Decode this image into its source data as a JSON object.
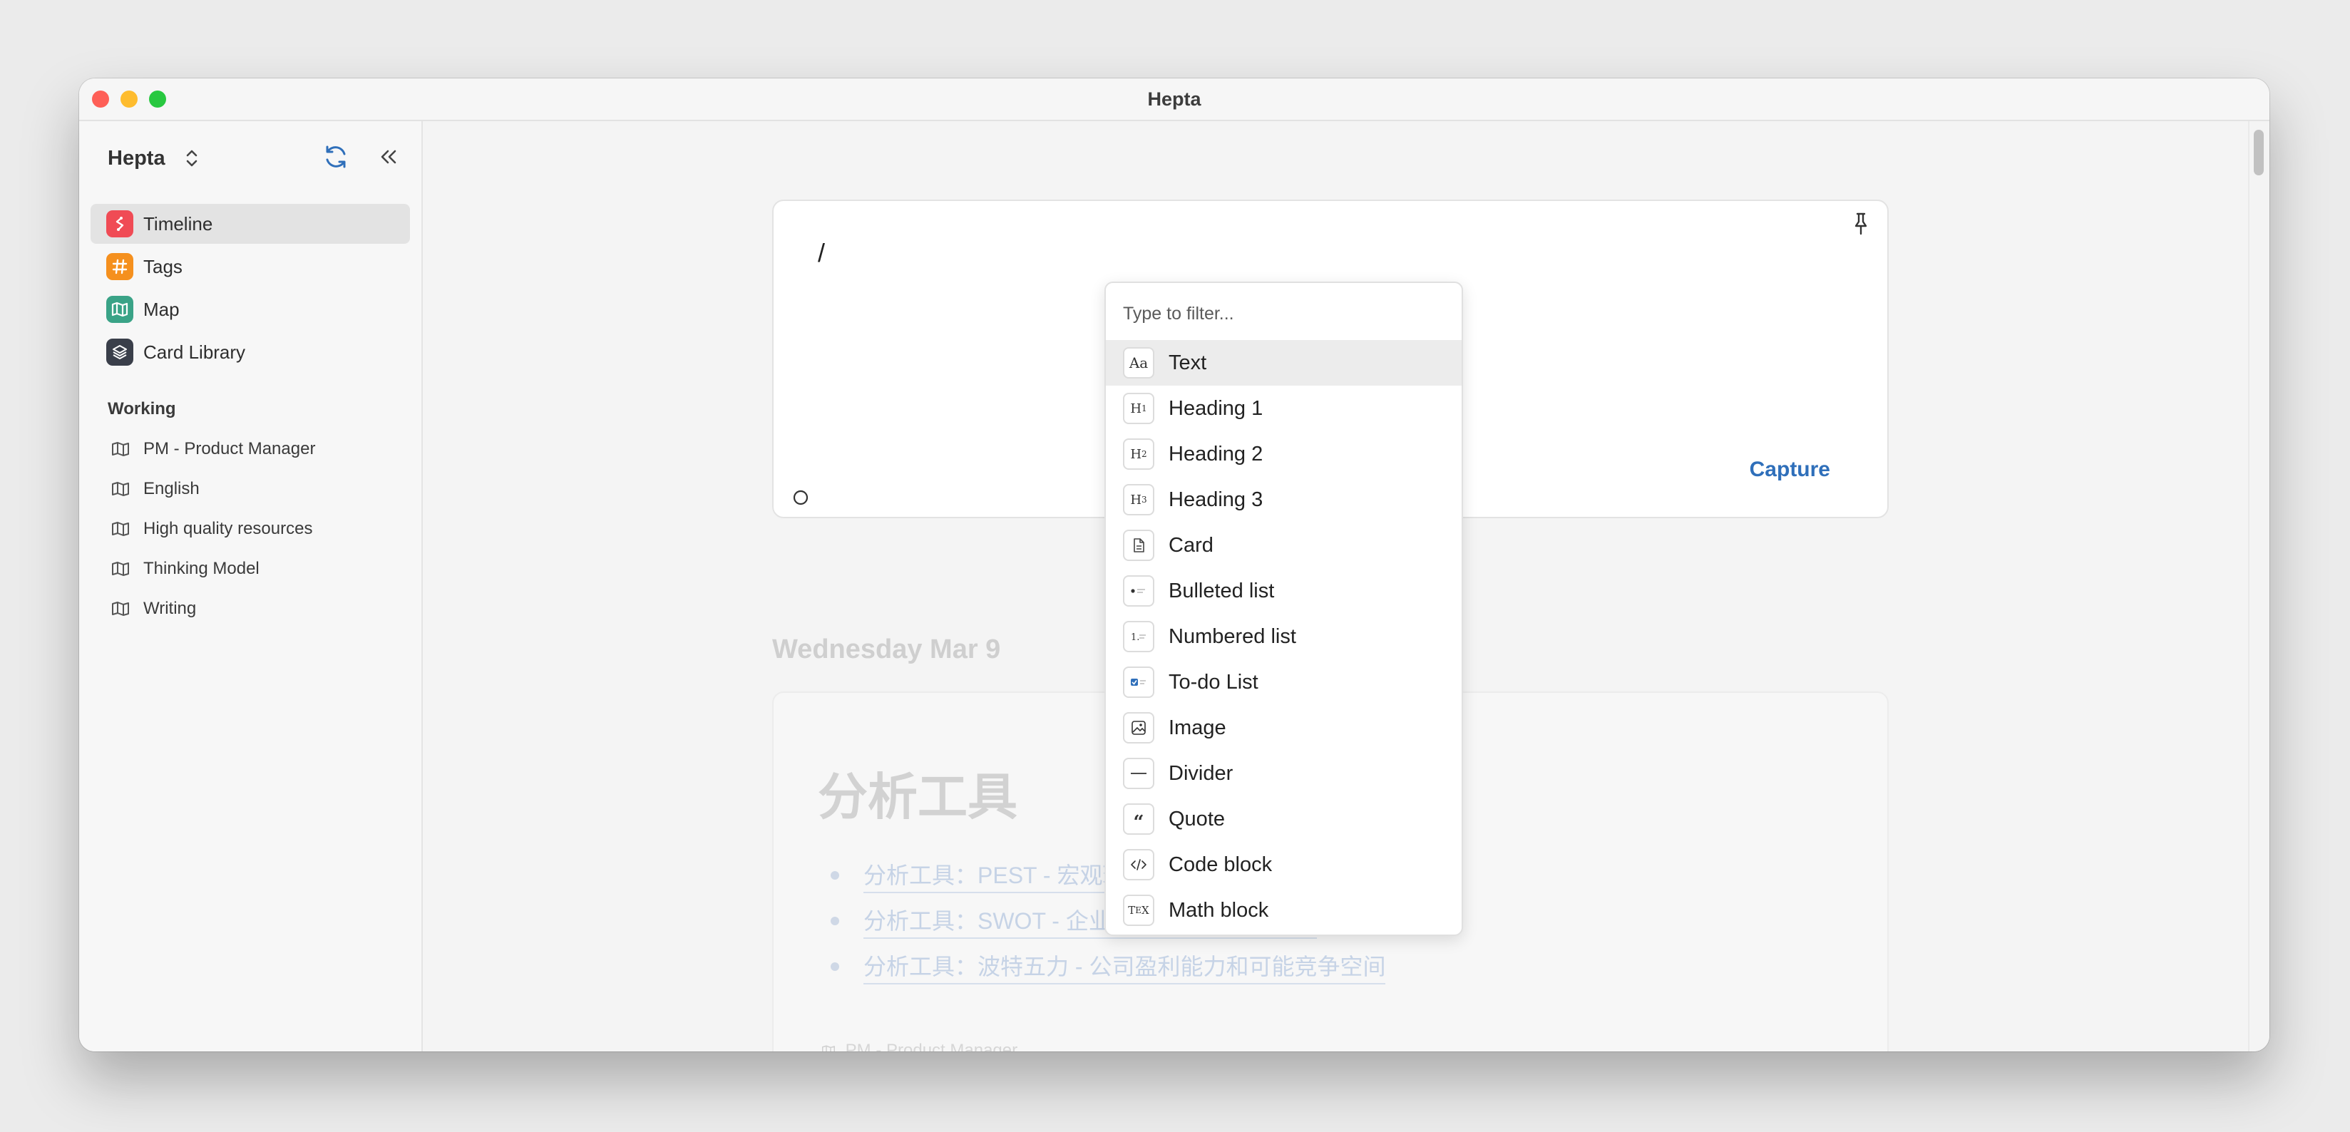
{
  "window": {
    "title": "Hepta"
  },
  "sidebar": {
    "workspace": "Hepta",
    "nav": [
      {
        "label": "Timeline",
        "icon": "timeline-icon",
        "color": "#f04b55",
        "active": true
      },
      {
        "label": "Tags",
        "icon": "hash-icon",
        "color": "#f5901e",
        "active": false
      },
      {
        "label": "Map",
        "icon": "map-icon",
        "color": "#3aa387",
        "active": false
      },
      {
        "label": "Card Library",
        "icon": "layers-icon",
        "color": "#3a3f4a",
        "active": false
      }
    ],
    "section_title": "Working",
    "working": [
      {
        "label": "PM - Product Manager"
      },
      {
        "label": "English"
      },
      {
        "label": "High quality resources"
      },
      {
        "label": "Thinking Model"
      },
      {
        "label": "Writing"
      }
    ]
  },
  "editor": {
    "content": "/",
    "capture_label": "Capture"
  },
  "timeline": {
    "date": "Wednesday Mar 9",
    "card_title": "分析工具",
    "links": [
      "分析工具：PEST - 宏观环境分析模型",
      "分析工具：SWOT - 企业内外部环境分析模型",
      "分析工具：波特五力 - 公司盈利能力和可能竞争空间"
    ],
    "footer_tag": "PM - Product Manager"
  },
  "slash_menu": {
    "filter_placeholder": "Type to filter...",
    "items": [
      {
        "label": "Text",
        "icon": "text-icon",
        "glyph": "Aa",
        "active": true
      },
      {
        "label": "Heading 1",
        "icon": "heading-1-icon",
        "glyph": "H1"
      },
      {
        "label": "Heading 2",
        "icon": "heading-2-icon",
        "glyph": "H2"
      },
      {
        "label": "Heading 3",
        "icon": "heading-3-icon",
        "glyph": "H3"
      },
      {
        "label": "Card",
        "icon": "card-icon",
        "glyph": ""
      },
      {
        "label": "Bulleted list",
        "icon": "bulleted-list-icon",
        "glyph": ""
      },
      {
        "label": "Numbered list",
        "icon": "numbered-list-icon",
        "glyph": ""
      },
      {
        "label": "To-do List",
        "icon": "todo-list-icon",
        "glyph": ""
      },
      {
        "label": "Image",
        "icon": "image-icon",
        "glyph": ""
      },
      {
        "label": "Divider",
        "icon": "divider-icon",
        "glyph": ""
      },
      {
        "label": "Quote",
        "icon": "quote-icon",
        "glyph": ""
      },
      {
        "label": "Code block",
        "icon": "code-block-icon",
        "glyph": ""
      },
      {
        "label": "Math block",
        "icon": "math-block-icon",
        "glyph": ""
      }
    ]
  },
  "colors": {
    "accent": "#2f6fba",
    "active_bg": "#e3e3e3"
  }
}
